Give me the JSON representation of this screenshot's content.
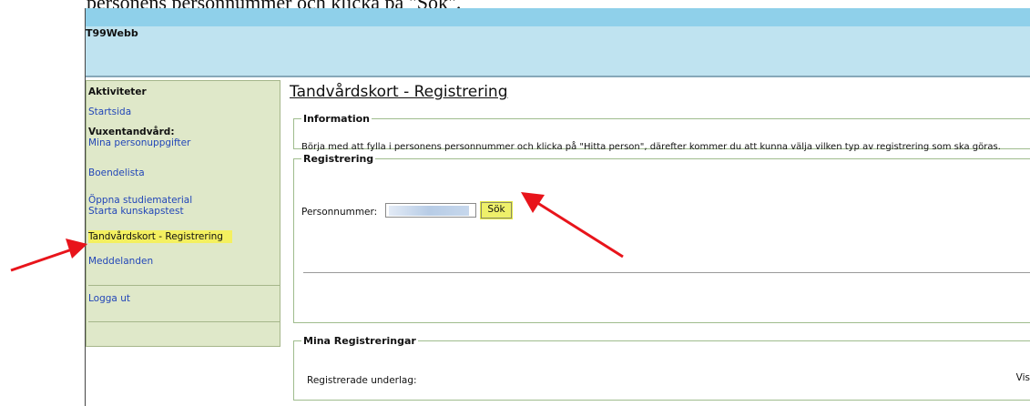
{
  "top_text": "personens personnummer och klicka på \"Sök\".",
  "app": {
    "title": "T99Webb"
  },
  "sidebar": {
    "activities_heading": "Aktiviteter",
    "startsida": "Startsida",
    "vuxen_heading": "Vuxentandvård:",
    "mina_personuppgifter": "Mina personuppgifter",
    "boendelista": "Boendelista",
    "oppna_studiematerial": "Öppna studiematerial",
    "starta_kunskapstest": "Starta kunskapstest",
    "tandvardskort_registrering": "Tandvårdskort - Registrering",
    "meddelanden": "Meddelanden",
    "logga_ut": "Logga ut"
  },
  "main": {
    "page_title": "Tandvårdskort - Registrering",
    "information": {
      "legend": "Information",
      "text": "Börja med att fylla i personens personnummer och klicka på \"Hitta person\", därefter kommer du att kunna välja vilken typ av registrering som ska göras."
    },
    "registrering": {
      "legend": "Registrering",
      "personnummer_label": "Personnummer:",
      "personnummer_value": "",
      "search_button": "Sök"
    },
    "mina_registreringar": {
      "legend": "Mina Registreringar",
      "registrerade_label": "Registrerade underlag:",
      "right_cut_text": "Vis"
    }
  },
  "annotations": {
    "arrow_color": "#e8141b",
    "highlight_color": "#f4f060"
  }
}
